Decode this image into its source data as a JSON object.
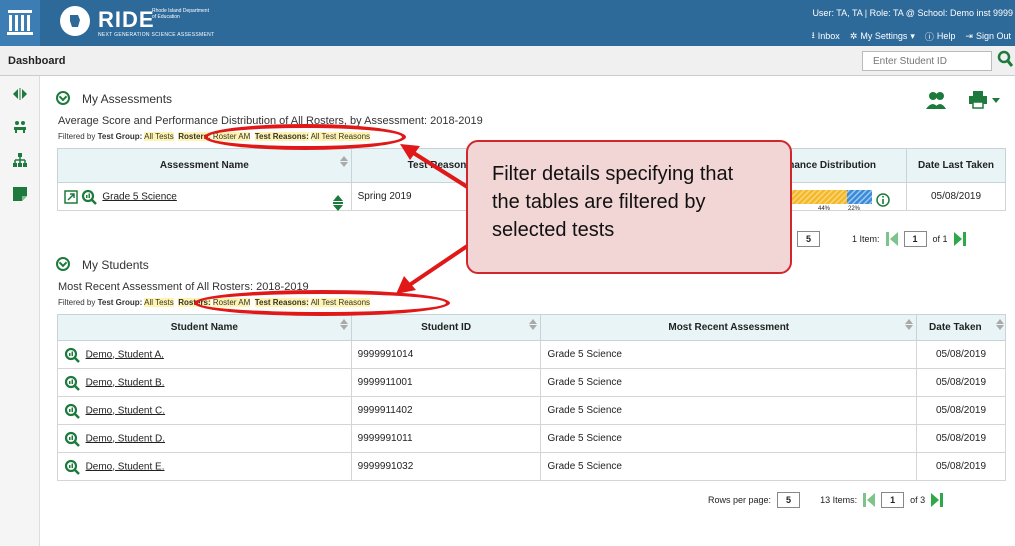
{
  "header": {
    "brand": "RIDE",
    "brand_sub": "Rhode Island Department of Education",
    "brand_tag": "NEXT GENERATION SCIENCE ASSESSMENT",
    "user_line": "User: TA, TA  |  Role: TA @ School: Demo inst 9999",
    "menu": {
      "inbox": "Inbox",
      "settings": "My Settings",
      "help": "Help",
      "signout": "Sign Out"
    }
  },
  "dashbar": {
    "title": "Dashboard",
    "student_id_placeholder": "Enter Student ID"
  },
  "assessments": {
    "title": "My Assessments",
    "subtitle": "Average Score and Performance Distribution of All Rosters, by Assessment: 2018-2019",
    "filter": {
      "prefix": "Filtered by",
      "group_label": "Test Group:",
      "group_value": "All Tests",
      "rosters_label": "Rosters:",
      "rosters_value": "Roster AM",
      "reasons_label": "Test Reasons:",
      "reasons_value": "All Test Reasons"
    },
    "columns": [
      "Assessment Name",
      "Test Reason",
      "nance Distribution",
      "Date Last Taken"
    ],
    "rows": [
      {
        "name": "Grade 5 Science",
        "reason": "Spring 2019",
        "dist_a": "44%",
        "dist_b": "22%",
        "date": "05/08/2019"
      }
    ],
    "pager": {
      "rows_per_page": "5",
      "items": "1 Item:",
      "page": "1",
      "of": "of 1"
    }
  },
  "students": {
    "title": "My Students",
    "subtitle": "Most Recent Assessment of All Rosters: 2018-2019",
    "filter": {
      "prefix": "Filtered by",
      "group_label": "Test Group:",
      "group_value": "All Tests",
      "rosters_label": "Rosters:",
      "rosters_value": "Roster AM",
      "reasons_label": "Test Reasons:",
      "reasons_value": "All Test Reasons"
    },
    "columns": [
      "Student Name",
      "Student ID",
      "Most Recent Assessment",
      "Date Taken"
    ],
    "rows": [
      {
        "name": "Demo, Student A.",
        "id": "9999991014",
        "assessment": "Grade 5 Science",
        "date": "05/08/2019"
      },
      {
        "name": "Demo, Student B.",
        "id": "9999911001",
        "assessment": "Grade 5 Science",
        "date": "05/08/2019"
      },
      {
        "name": "Demo, Student C.",
        "id": "9999911402",
        "assessment": "Grade 5 Science",
        "date": "05/08/2019"
      },
      {
        "name": "Demo, Student D.",
        "id": "9999991011",
        "assessment": "Grade 5 Science",
        "date": "05/08/2019"
      },
      {
        "name": "Demo, Student E.",
        "id": "9999991032",
        "assessment": "Grade 5 Science",
        "date": "05/08/2019"
      }
    ],
    "pager": {
      "rows_label": "Rows per page:",
      "rows_per_page": "5",
      "items": "13 Items:",
      "page": "1",
      "of": "of 3"
    }
  },
  "callout": {
    "text": "Filter details specifying that the tables are filtered by selected tests"
  },
  "colors": {
    "header": "#2d6a9a",
    "accent_green": "#1d7a3c",
    "annotation_red": "#e01818",
    "table_header": "#e9f4f7"
  }
}
